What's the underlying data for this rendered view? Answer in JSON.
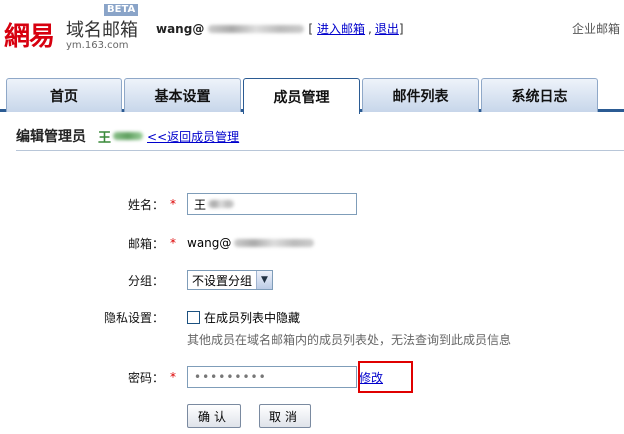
{
  "header": {
    "logo_text": "網易",
    "logo_title": "域名邮箱",
    "logo_domain": "ym.163.com",
    "beta_badge": "BETA",
    "username": "wang@",
    "bracket_open": "[",
    "enter_mailbox": "进入邮箱",
    "separator": ",",
    "logout": "退出",
    "bracket_close": "]",
    "enterprise_mail": "企业邮箱"
  },
  "tabs": [
    {
      "label": "首页",
      "active": false
    },
    {
      "label": "基本设置",
      "active": false
    },
    {
      "label": "成员管理",
      "active": true
    },
    {
      "label": "邮件列表",
      "active": false
    },
    {
      "label": "系统日志",
      "active": false
    }
  ],
  "page": {
    "title": "编辑管理员",
    "member_name_prefix": "王",
    "back_link": "<<返回成员管理"
  },
  "form": {
    "name_label": "姓名：",
    "name_value": "王",
    "email_label": "邮箱：",
    "email_value": "wang@",
    "group_label": "分组：",
    "group_value": "不设置分组",
    "privacy_label": "隐私设置：",
    "privacy_option": "在成员列表中隐藏",
    "privacy_hint": "其他成员在域名邮箱内的成员列表处，无法查询到此成员信息",
    "password_label": "密码：",
    "password_mask": "•••••••••",
    "modify_link": "修改",
    "required_mark": "*",
    "confirm_button": "确认",
    "cancel_button": "取消"
  },
  "colors": {
    "brand_red": "#d7000f",
    "tab_border": "#2b5b93",
    "link": "#0000cc",
    "highlight_box": "#e00000"
  }
}
